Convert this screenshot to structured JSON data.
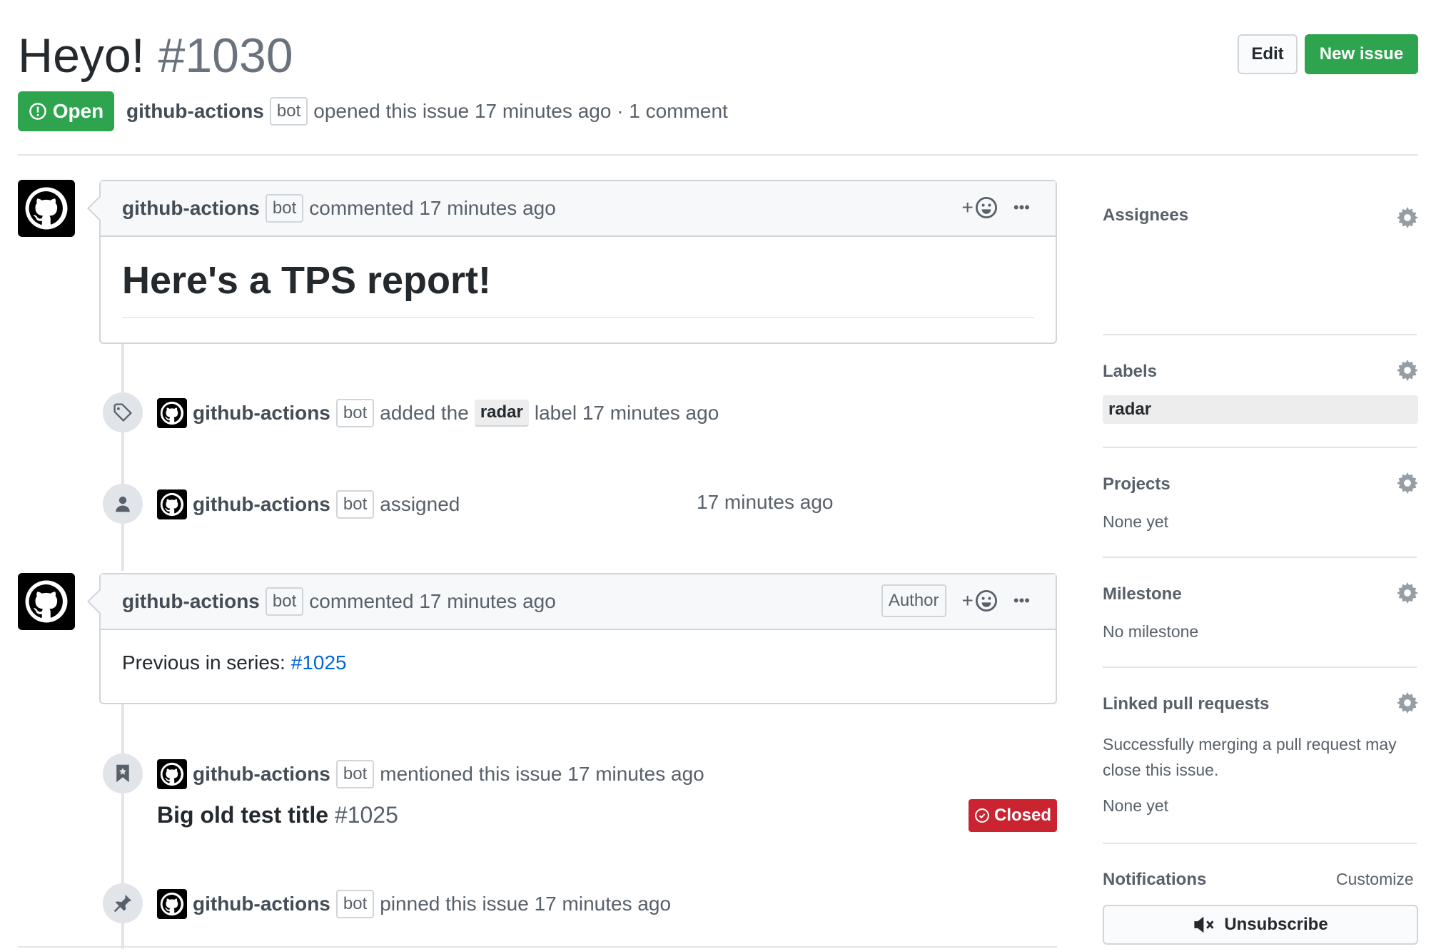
{
  "header": {
    "title": "Heyo!",
    "number": "#1030",
    "edit_label": "Edit",
    "new_issue_label": "New issue",
    "state_label": "Open",
    "author": "github-actions",
    "bot_label": "bot",
    "meta_text": "opened this issue 17 minutes ago · 1 comment"
  },
  "comment1": {
    "author": "github-actions",
    "bot_label": "bot",
    "time_text": "commented 17 minutes ago",
    "heading": "Here's a TPS report!",
    "reaction_label": "+",
    "more_label": "•••"
  },
  "event_label": {
    "author": "github-actions",
    "bot_label": "bot",
    "prefix": "added the",
    "label": "radar",
    "suffix": "label 17 minutes ago"
  },
  "event_assign": {
    "author": "github-actions",
    "bot_label": "bot",
    "text": "assigned",
    "time": "17 minutes ago"
  },
  "comment2": {
    "author": "github-actions",
    "bot_label": "bot",
    "time_text": "commented 17 minutes ago",
    "author_badge": "Author",
    "reaction_label": "+",
    "more_label": "•••",
    "body_prefix": "Previous in series:",
    "body_link": "#1025"
  },
  "event_mention": {
    "author": "github-actions",
    "bot_label": "bot",
    "text": "mentioned this issue 17 minutes ago",
    "ref_title": "Big old test title",
    "ref_number": "#1025",
    "ref_state": "Closed"
  },
  "event_pin": {
    "author": "github-actions",
    "bot_label": "bot",
    "text": "pinned this issue 17 minutes ago"
  },
  "sidebar": {
    "assignees_title": "Assignees",
    "labels_title": "Labels",
    "label_value": "radar",
    "projects_title": "Projects",
    "projects_value": "None yet",
    "milestone_title": "Milestone",
    "milestone_value": "No milestone",
    "linked_title": "Linked pull requests",
    "linked_desc_1": "Successfully merging a pull request may",
    "linked_desc_2": "close this issue.",
    "linked_value": "None yet",
    "notifications_title": "Notifications",
    "customize_label": "Customize",
    "unsubscribe_label": "Unsubscribe"
  },
  "colors": {
    "open_green": "#2ea44f",
    "closed_red": "#cb2431",
    "link_blue": "#0366d6"
  }
}
